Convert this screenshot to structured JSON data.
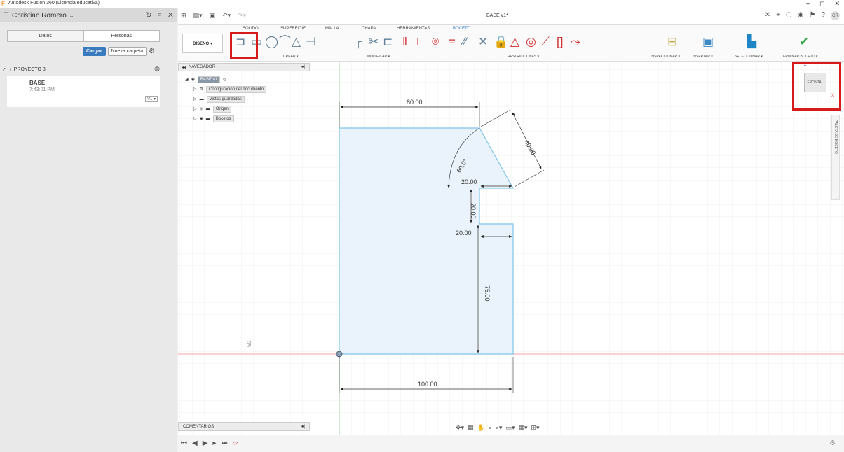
{
  "window": {
    "title": "Autodesk Fusion 360 (Licencia educativa)",
    "minimize": "–",
    "maximize": "◻",
    "close": "✕"
  },
  "datapanel": {
    "user": "Christian Romero",
    "tabs": [
      "Datos",
      "Personas"
    ],
    "upload_label": "Cargar",
    "new_folder_label": "Nueva carpeta",
    "project": "PROYECTO 3",
    "file": {
      "name": "BASE",
      "time": "7:43:01 PM",
      "version": "V1 ▾"
    }
  },
  "header": {
    "doc_title": "BASE v1*"
  },
  "ribbon": {
    "tabs": [
      "SÓLIDO",
      "SUPERFICIE",
      "MALLA",
      "CHAPA",
      "HERRAMIENTAS",
      "BOCETO"
    ],
    "active_tab": "BOCETO",
    "workspace": "DISEÑO ▾",
    "groups": {
      "crear": "CREAR ▾",
      "modificar": "MODIFICAR ▾",
      "restricciones": "RESTRICCIONES ▾",
      "inspeccionar": "INSPECCIONAR ▾",
      "insertar": "INSERTAR ▾",
      "seleccionar": "SELECCIONAR ▾",
      "terminar": "TERMINAR BOCETO ▾"
    }
  },
  "navigator": {
    "title": "NAVEGADOR",
    "items": [
      {
        "label": "BASE v1"
      },
      {
        "label": "Configuración del documento"
      },
      {
        "label": "Vistas guardadas"
      },
      {
        "label": "Origen"
      },
      {
        "label": "Bocetos"
      }
    ]
  },
  "comments": {
    "title": "COMENTARIOS"
  },
  "viewcube": {
    "face": "FRONTAL",
    "z_label": "Z",
    "x_label": "X"
  },
  "palette": {
    "label": "PALETA DE BOCETO"
  },
  "sketch": {
    "dimensions": {
      "top_width": "80.00",
      "angle": "60.0°",
      "slant": "40.00",
      "notch_upper_depth": "20.00",
      "notch_height": "20.00",
      "notch_lower_depth": "20.00",
      "right_height": "75.00",
      "bottom_width": "100.00"
    },
    "grid_label": "50"
  },
  "colors": {
    "highlight": "#d61a1a",
    "sketch_line": "#7fc4e8",
    "sketch_fill": "#eaf3fb",
    "x_axis": "#f3a7a7",
    "y_axis": "#9fd89f",
    "ribbon_active": "#1d6fc2"
  }
}
